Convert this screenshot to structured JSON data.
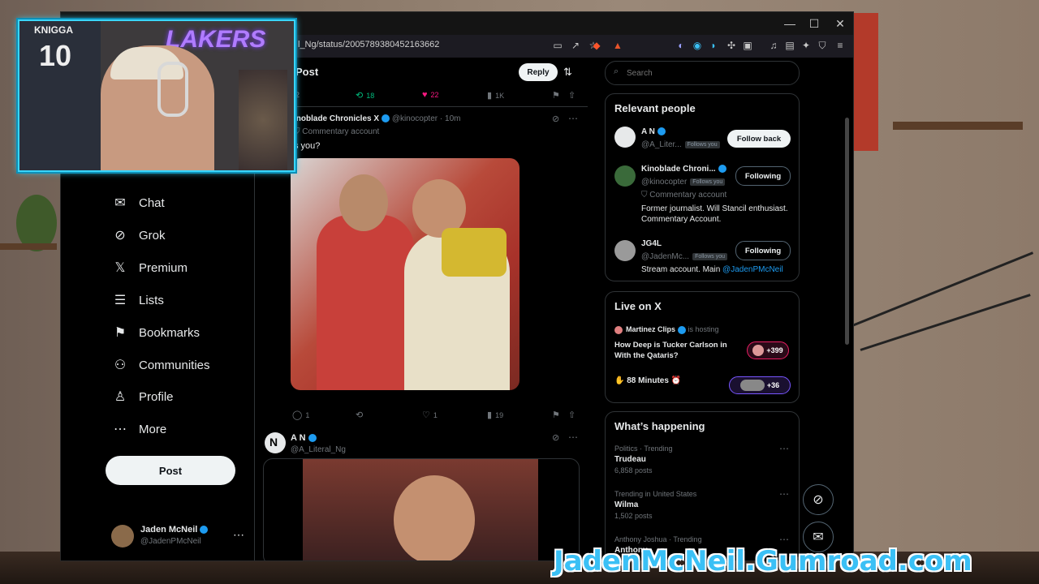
{
  "browser": {
    "url": "l_Ng/status/2005789380452163662"
  },
  "nav": {
    "items": [
      {
        "label": "Chat",
        "icon": "chat-icon",
        "glyph": "✉"
      },
      {
        "label": "Grok",
        "icon": "grok-icon",
        "glyph": "⊘"
      },
      {
        "label": "Premium",
        "icon": "x-logo-icon",
        "glyph": "𝕏"
      },
      {
        "label": "Lists",
        "icon": "lists-icon",
        "glyph": "☰"
      },
      {
        "label": "Bookmarks",
        "icon": "bookmark-icon",
        "glyph": "⚑"
      },
      {
        "label": "Communities",
        "icon": "communities-icon",
        "glyph": "⚇"
      },
      {
        "label": "Profile",
        "icon": "profile-icon",
        "glyph": "♙"
      },
      {
        "label": "More",
        "icon": "more-icon",
        "glyph": "⋯"
      }
    ],
    "post_label": "Post",
    "me": {
      "name": "Jaden McNeil",
      "handle": "@JadenPMcNeil"
    }
  },
  "header": {
    "title": "Post",
    "reply_label": "Reply"
  },
  "top_actions": {
    "replies": "2",
    "reposts": "18",
    "likes": "22",
    "views": "1K"
  },
  "quote_post": {
    "name": "inoblade Chronicles X",
    "handle": "@kinocopter",
    "time": "10m",
    "label": "Commentary account",
    "text": "s you?",
    "replies": "1",
    "likes": "1",
    "views": "19"
  },
  "reply_post": {
    "name": "A N",
    "handle": "@A_Literal_Ng"
  },
  "search": {
    "placeholder": "Search"
  },
  "relevant": {
    "title": "Relevant people",
    "people": [
      {
        "name": "A N",
        "handle": "@A_Liter...",
        "follows_you": "Follows you",
        "button": "Follow back",
        "bio": "",
        "label": ""
      },
      {
        "name": "Kinoblade Chroni...",
        "handle": "@kinocopter",
        "follows_you": "Follows you",
        "button": "Following",
        "label": "Commentary account",
        "bio": "Former journalist. Will Stancil enthusiast. Commentary Account."
      },
      {
        "name": "JG4L",
        "handle": "@JadenMc...",
        "follows_you": "Follows you",
        "button": "Following",
        "label": "",
        "bio": "Stream account. Main ",
        "bio_link": "@JadenPMcNeil"
      }
    ]
  },
  "live": {
    "title": "Live on X",
    "host": "Martinez Clips",
    "hosting": "is hosting",
    "space_title": "How Deep is Tucker Carlson in With the Qataris?",
    "count1": "+399",
    "row2": "✋ 88 Minutes ⏰",
    "count2": "+36"
  },
  "happening": {
    "title": "What’s happening",
    "trends": [
      {
        "context": "Politics · Trending",
        "name": "Trudeau",
        "posts": "6,858 posts"
      },
      {
        "context": "Trending in United States",
        "name": "Wilma",
        "posts": "1,502 posts"
      },
      {
        "context": "Anthony Joshua · Trending",
        "name": "Anthony",
        "posts": ""
      }
    ]
  },
  "overlay": {
    "jersey_text": "KNIGGA",
    "jersey_number": "10",
    "banner": "LAKERS",
    "gumroad": "JadenMcNeil.Gumroad.com"
  },
  "colors": {
    "accent": "#1d9bf0",
    "like": "#f91880",
    "repost": "#00ba7c",
    "overlay_cyan": "#39d6ff"
  }
}
